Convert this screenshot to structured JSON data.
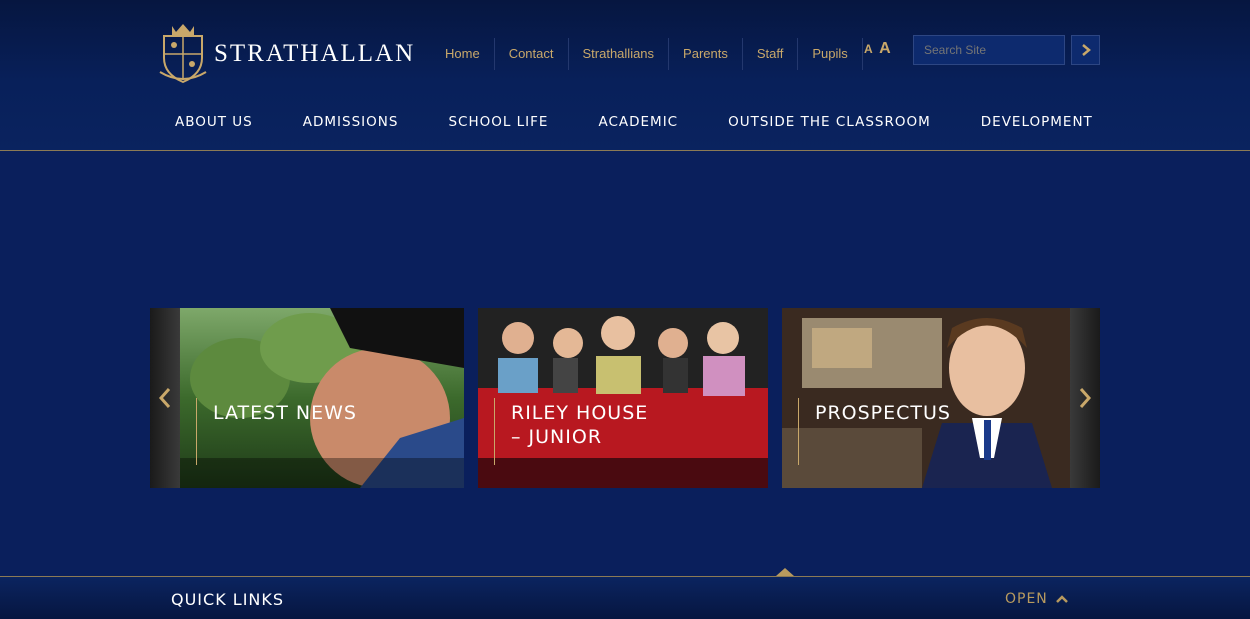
{
  "brand": {
    "name": "STRATHALLAN",
    "logo_icon": "crest-icon"
  },
  "toplinks": [
    "Home",
    "Contact",
    "Strathallians",
    "Parents",
    "Staff",
    "Pupils"
  ],
  "text_size": {
    "small": "A",
    "large": "A"
  },
  "search": {
    "placeholder": "Search Site",
    "button_icon": "chevron-right-icon"
  },
  "main_nav": [
    "ABOUT US",
    "ADMISSIONS",
    "SCHOOL LIFE",
    "ACADEMIC",
    "OUTSIDE THE CLASSROOM",
    "DEVELOPMENT"
  ],
  "carousel": {
    "cards": [
      {
        "line1": "LATEST NEWS",
        "line2": ""
      },
      {
        "line1": "RILEY HOUSE",
        "line2": "– JUNIOR"
      },
      {
        "line1": "PROSPECTUS",
        "line2": ""
      }
    ],
    "prev_icon": "chevron-left-icon",
    "next_icon": "chevron-right-icon"
  },
  "quick_links": {
    "title": "QUICK LINKS",
    "toggle": "OPEN",
    "toggle_icon": "chevron-up-icon"
  },
  "colors": {
    "background": "#0a1f5c",
    "gold": "#c9a86a",
    "text": "#ffffff"
  }
}
